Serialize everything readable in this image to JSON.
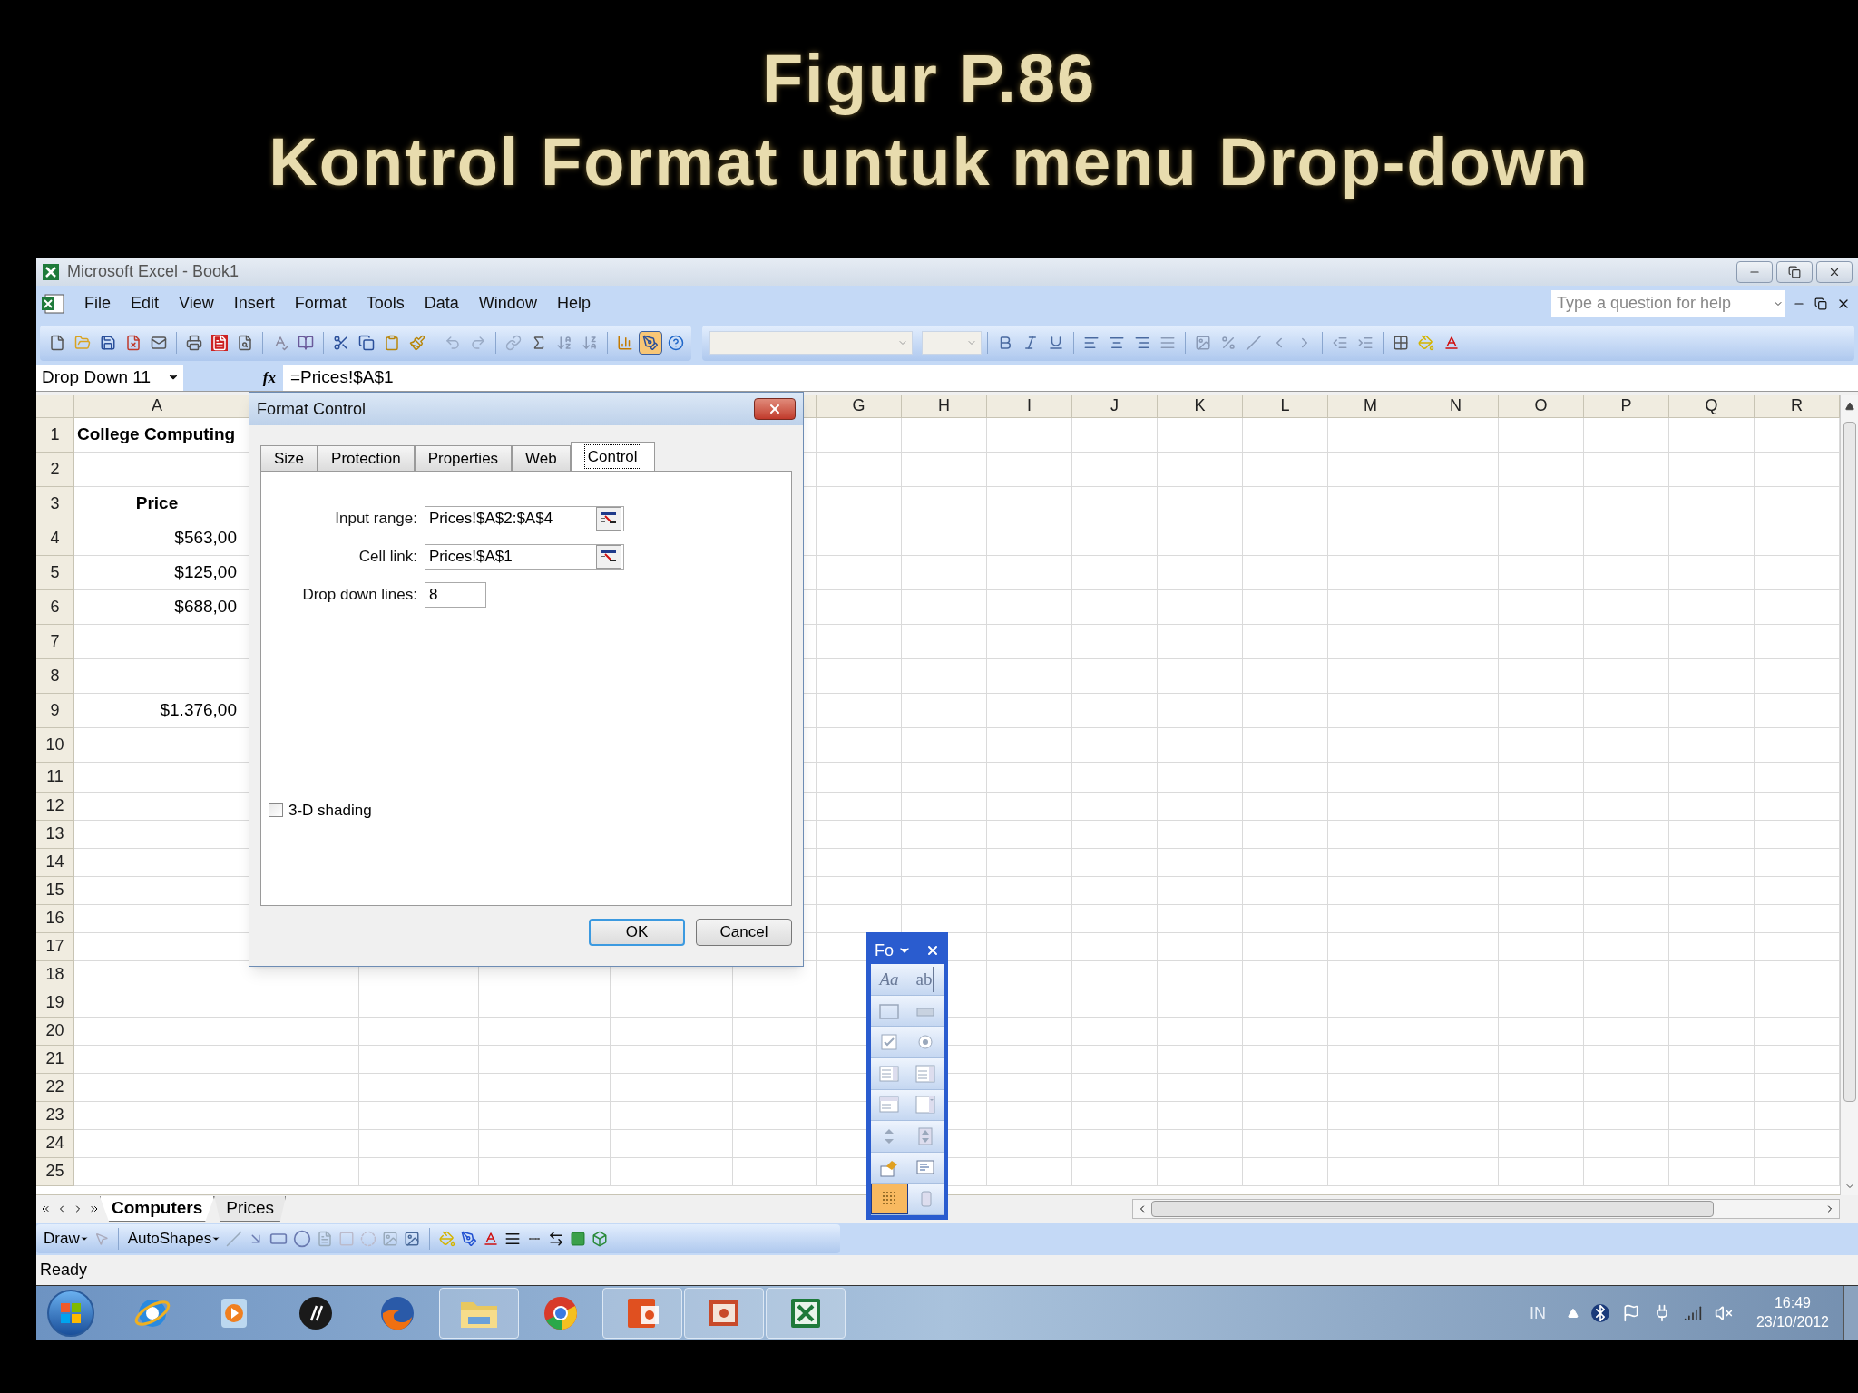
{
  "slide": {
    "title_lines": [
      "Figur P.86",
      "Kontrol Format untuk menu Drop-down"
    ]
  },
  "window": {
    "title": "Microsoft Excel - Book1"
  },
  "menu": [
    "File",
    "Edit",
    "View",
    "Insert",
    "Format",
    "Tools",
    "Data",
    "Window",
    "Help"
  ],
  "help_box": {
    "placeholder": "Type a question for help"
  },
  "standard_toolbar": {
    "drawing_pressed": true
  },
  "formula_bar": {
    "name_box": "Drop Down 11",
    "fx": "fx",
    "formula": "=Prices!$A$1"
  },
  "columns": [
    "A",
    "G",
    "H",
    "I",
    "J",
    "K",
    "L",
    "M",
    "N",
    "O",
    "P",
    "Q",
    "R"
  ],
  "rows": [
    {
      "number": "1",
      "cell_a": {
        "text": "College Computing",
        "kind": "title"
      }
    },
    {
      "number": "2"
    },
    {
      "number": "3",
      "cell_a": {
        "text": "Price",
        "kind": "header"
      }
    },
    {
      "number": "4",
      "cell_a": {
        "text": "$563,00",
        "kind": "value"
      }
    },
    {
      "number": "5",
      "cell_a": {
        "text": "$125,00",
        "kind": "value"
      }
    },
    {
      "number": "6",
      "cell_a": {
        "text": "$688,00",
        "kind": "value"
      }
    },
    {
      "number": "7"
    },
    {
      "number": "8"
    },
    {
      "number": "9",
      "cell_a": {
        "text": "$1.376,00",
        "kind": "value"
      }
    },
    {
      "number": "10"
    },
    {
      "number": "11"
    },
    {
      "number": "12"
    },
    {
      "number": "13"
    },
    {
      "number": "14"
    },
    {
      "number": "15"
    },
    {
      "number": "16"
    },
    {
      "number": "17"
    },
    {
      "number": "18"
    },
    {
      "number": "19"
    },
    {
      "number": "20"
    },
    {
      "number": "21"
    },
    {
      "number": "22"
    },
    {
      "number": "23"
    },
    {
      "number": "24"
    },
    {
      "number": "25"
    }
  ],
  "dialog": {
    "title": "Format Control",
    "tabs": [
      {
        "label": "Size",
        "selected": false
      },
      {
        "label": "Protection",
        "selected": false
      },
      {
        "label": "Properties",
        "selected": false
      },
      {
        "label": "Web",
        "selected": false
      },
      {
        "label": "Control",
        "selected": true
      }
    ],
    "fields": [
      {
        "label": "Input range:",
        "value": "Prices!$A$2:$A$4",
        "kind": "reference"
      },
      {
        "label": "Cell link:",
        "value": "Prices!$A$1",
        "kind": "reference"
      },
      {
        "label": "Drop down lines:",
        "value": "8",
        "kind": "number"
      }
    ],
    "shading": {
      "label": "3-D shading",
      "checked": false
    },
    "buttons": [
      {
        "label": "OK",
        "default": true
      },
      {
        "label": "Cancel",
        "default": false
      }
    ]
  },
  "forms_toolbar": {
    "title": "Fo",
    "tools": [
      {
        "kind": "label",
        "glyph": "Aa",
        "selected": false
      },
      {
        "kind": "edit_box",
        "glyph": "ab",
        "selected": false
      },
      {
        "kind": "group_box",
        "selected": false
      },
      {
        "kind": "button",
        "selected": false
      },
      {
        "kind": "checkbox",
        "selected": false
      },
      {
        "kind": "option",
        "selected": false
      },
      {
        "kind": "list",
        "selected": false
      },
      {
        "kind": "combo",
        "selected": false
      },
      {
        "kind": "combo_list",
        "selected": false
      },
      {
        "kind": "combo_drop",
        "selected": false
      },
      {
        "kind": "scroll",
        "selected": false
      },
      {
        "kind": "spinner",
        "selected": false
      },
      {
        "kind": "properties",
        "selected": false
      },
      {
        "kind": "code",
        "selected": false
      },
      {
        "kind": "grid",
        "selected": true
      },
      {
        "kind": "run",
        "selected": false
      }
    ]
  },
  "sheet_tabs": [
    {
      "label": "Computers",
      "selected": true
    },
    {
      "label": "Prices",
      "selected": false
    }
  ],
  "draw_toolbar": {
    "draw": "Draw",
    "autoshapes": "AutoShapes"
  },
  "status_bar": {
    "text": "Ready"
  },
  "taskbar": {
    "apps": [
      {
        "kind": "browser_e",
        "running": false
      },
      {
        "kind": "media",
        "running": false
      },
      {
        "kind": "hp",
        "running": false
      },
      {
        "kind": "fox",
        "running": false
      },
      {
        "kind": "folder",
        "running": true
      },
      {
        "kind": "chrome",
        "running": false
      },
      {
        "kind": "slides",
        "running": true
      },
      {
        "kind": "slideshow",
        "running": true
      },
      {
        "kind": "sheet",
        "running": true
      }
    ],
    "language": "IN",
    "time": "16:49",
    "date": "23/10/2012"
  }
}
